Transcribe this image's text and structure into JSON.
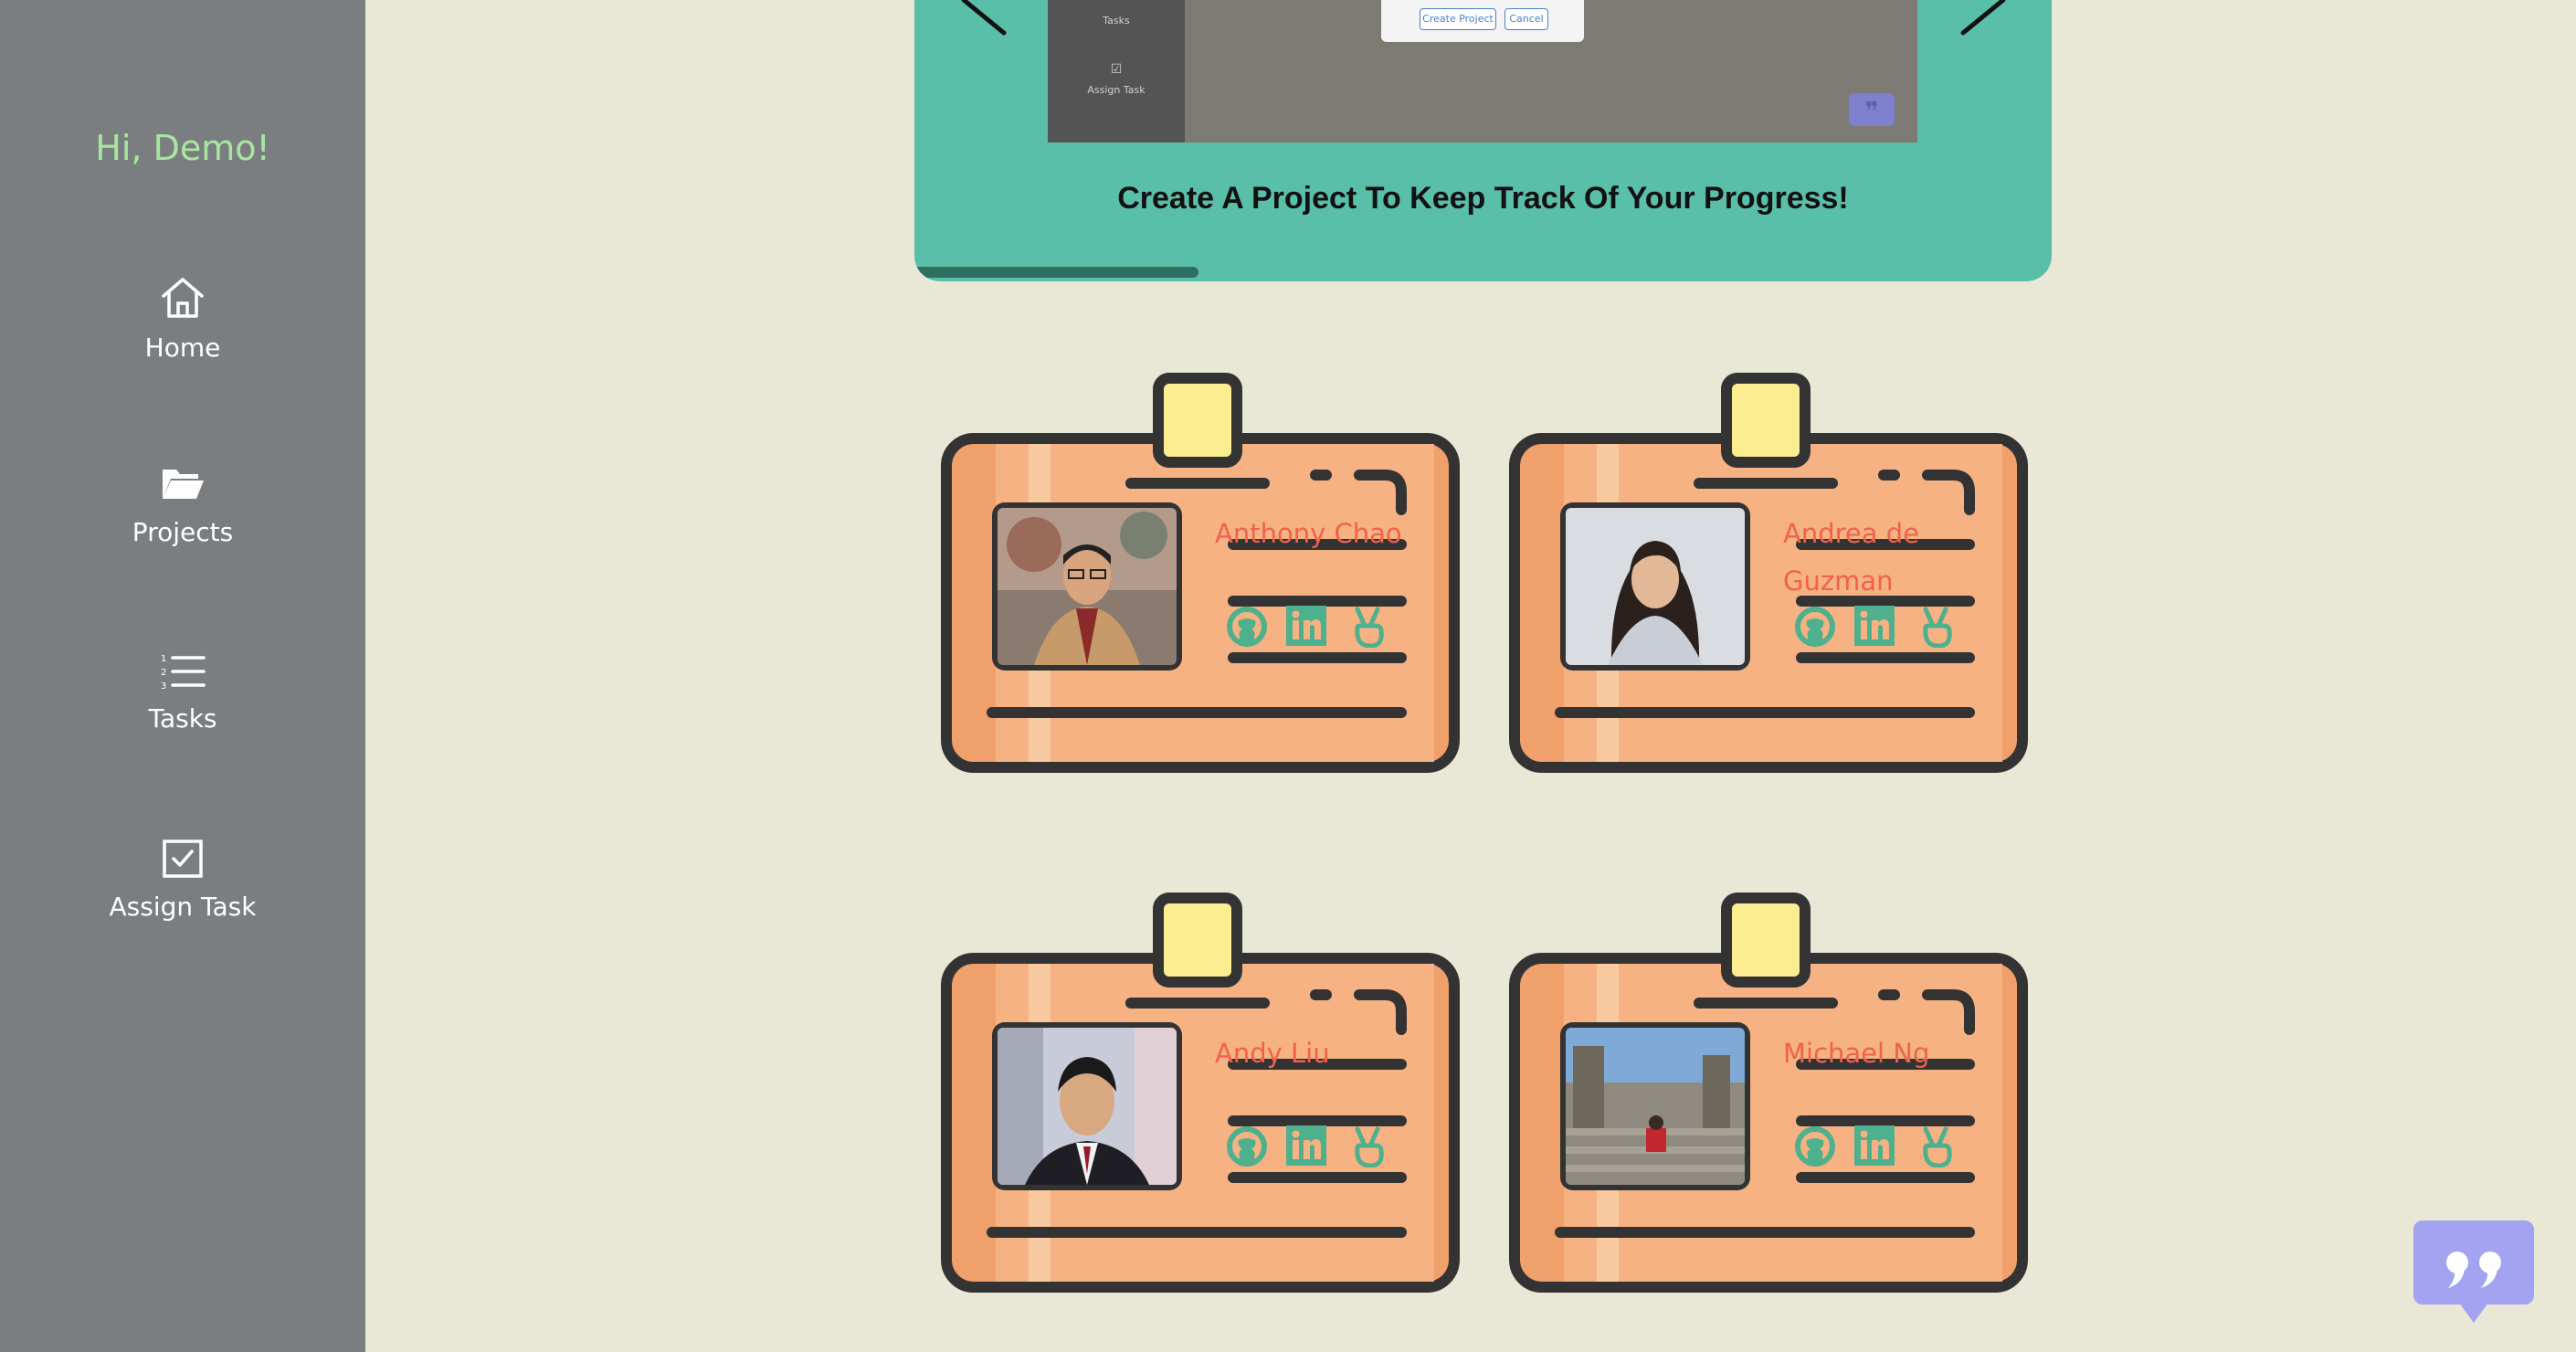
{
  "sidebar": {
    "greeting": "Hi, Demo!",
    "items": [
      {
        "label": "Home",
        "icon": "home-icon"
      },
      {
        "label": "Projects",
        "icon": "folder-open-icon"
      },
      {
        "label": "Tasks",
        "icon": "list-numbered-icon"
      },
      {
        "label": "Assign Task",
        "icon": "checkbox-icon"
      }
    ]
  },
  "carousel": {
    "caption": "Create A Project To Keep Track Of Your Progress!",
    "progress": 0.25,
    "preview": {
      "sidebar_items": [
        "Tasks",
        "Assign Task"
      ],
      "buttons": [
        "Create Project",
        "Cancel"
      ]
    }
  },
  "team": [
    {
      "name": "Anthony Chao",
      "links": [
        "github-icon",
        "linkedin-icon",
        "peace-hand-icon"
      ]
    },
    {
      "name": "Andrea de Guzman",
      "links": [
        "github-icon",
        "linkedin-icon",
        "peace-hand-icon"
      ]
    },
    {
      "name": "Andy Liu",
      "links": [
        "github-icon",
        "linkedin-icon",
        "peace-hand-icon"
      ]
    },
    {
      "name": "Michael Ng",
      "links": [
        "github-icon",
        "linkedin-icon",
        "peace-hand-icon"
      ]
    }
  ],
  "colors": {
    "background": "#e9e7d6",
    "sidebar": "#7b7e80",
    "greeting": "#a8e6a0",
    "carousel": "#5abfa9",
    "badge_orange": "#f4a671",
    "name_red": "#f0614e",
    "social_green": "#4fb08e",
    "quote_purple": "#a3a3f2"
  }
}
